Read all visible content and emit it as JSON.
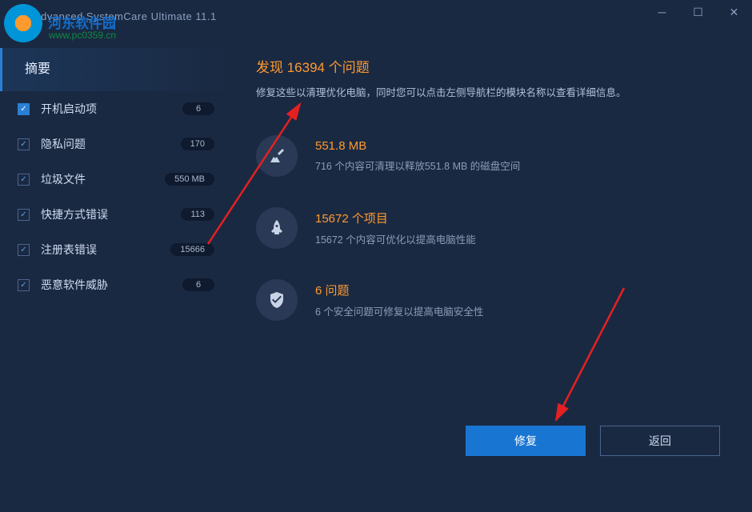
{
  "app": {
    "title": "Advanced SystemCare Ultimate  11.1"
  },
  "watermark": {
    "text": "河东软件园",
    "url": "www.pc0359.cn"
  },
  "sidebar": {
    "header": "摘要",
    "items": [
      {
        "label": "开机启动项",
        "count": "6",
        "filled": true
      },
      {
        "label": "隐私问题",
        "count": "170",
        "filled": false
      },
      {
        "label": "垃圾文件",
        "count": "550 MB",
        "filled": false
      },
      {
        "label": "快捷方式错误",
        "count": "113",
        "filled": false
      },
      {
        "label": "注册表错误",
        "count": "15666",
        "filled": false
      },
      {
        "label": "恶意软件威胁",
        "count": "6",
        "filled": false
      }
    ]
  },
  "main": {
    "headline": "发现 16394 个问题",
    "subheadline": "修复这些以清理优化电脑，同时您可以点击左侧导航栏的模块名称以查看详细信息。",
    "cards": [
      {
        "icon": "broom",
        "title": "551.8 MB",
        "desc": "716 个内容可清理以释放551.8 MB 的磁盘空间"
      },
      {
        "icon": "rocket",
        "title": "15672 个项目",
        "desc": "15672 个内容可优化以提高电脑性能"
      },
      {
        "icon": "shield",
        "title": "6 问题",
        "desc": "6 个安全问题可修复以提高电脑安全性"
      }
    ],
    "buttons": {
      "primary": "修复",
      "secondary": "返回"
    }
  }
}
